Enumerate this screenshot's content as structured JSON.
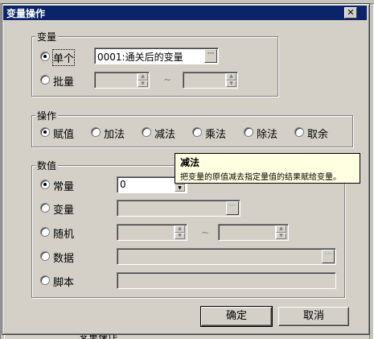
{
  "dialog": {
    "title": "变量操作",
    "close_symbol": "✕"
  },
  "variable_group": {
    "label": "变量",
    "single_label": "单个",
    "single_value": "0001:通关后的变量",
    "batch_label": "批量",
    "range_separator": "~"
  },
  "operation_group": {
    "label": "操作",
    "options": [
      "赋值",
      "加法",
      "减法",
      "乘法",
      "除法",
      "取余"
    ],
    "selected": "赋值"
  },
  "value_group": {
    "label": "数值",
    "constant_label": "常量",
    "constant_value": "0",
    "variable_label": "变量",
    "random_label": "随机",
    "random_separator": "~",
    "data_label": "数据",
    "script_label": "脚本"
  },
  "tooltip": {
    "title": "减法",
    "text": "把变量的原值减去指定量值的结果赋给变量。"
  },
  "buttons": {
    "ok": "确定",
    "cancel": "取消"
  },
  "background_window": {
    "bottom_text": "变量操作"
  },
  "icons": {
    "dots": "ellipsis-icon",
    "spin_up": "spin-up-icon",
    "spin_down": "spin-down-icon"
  }
}
